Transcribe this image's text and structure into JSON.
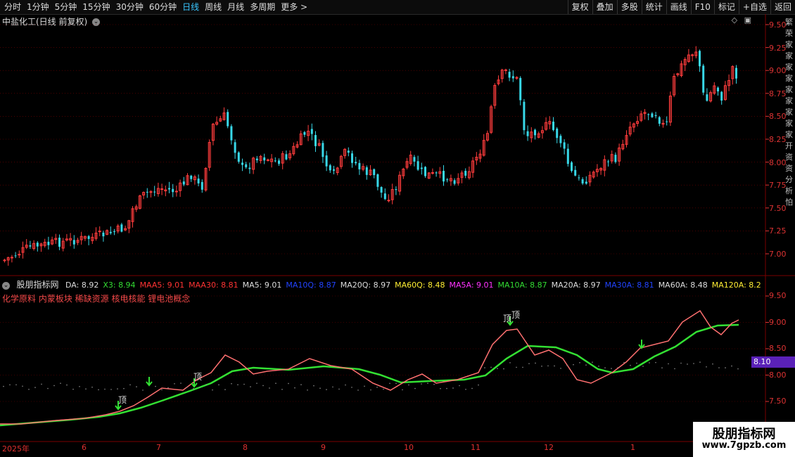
{
  "toolbar": {
    "periods": [
      "分时",
      "1分钟",
      "5分钟",
      "15分钟",
      "30分钟",
      "60分钟",
      "日线",
      "周线",
      "月线",
      "多周期",
      "更多 >"
    ],
    "active_period": "日线",
    "actions": [
      "复权",
      "叠加",
      "多股",
      "统计",
      "画线",
      "F10",
      "标记",
      "+自选",
      "返回"
    ]
  },
  "main_chart": {
    "title": "中盐化工(日线 前复权)",
    "price_ticks": [
      "9.50",
      "9.25",
      "9.00",
      "8.75",
      "8.50",
      "8.25",
      "8.00",
      "7.75",
      "7.50",
      "7.25",
      "7.00"
    ],
    "side_text": "繁荣家家家家家家家家家开资资分析怕"
  },
  "indicator": {
    "name": "股朋指标网",
    "values": [
      {
        "label": "DA: 8.92",
        "color": "#dddddd"
      },
      {
        "label": "X3: 8.94",
        "color": "#33dd33"
      },
      {
        "label": "MAA5: 9.01",
        "color": "#ff3333"
      },
      {
        "label": "MAA30: 8.81",
        "color": "#ff3333"
      },
      {
        "label": "MA5: 9.01",
        "color": "#dddddd"
      },
      {
        "label": "MA10Q: 8.87",
        "color": "#2244ff"
      },
      {
        "label": "MA20Q: 8.97",
        "color": "#dddddd"
      },
      {
        "label": "MA60Q: 8.48",
        "color": "#ffee33"
      },
      {
        "label": "MA5A: 9.01",
        "color": "#ff33ff"
      },
      {
        "label": "MA10A: 8.87",
        "color": "#33dd33"
      },
      {
        "label": "MA20A: 8.97",
        "color": "#dddddd"
      },
      {
        "label": "MA30A: 8.81",
        "color": "#2244ff"
      },
      {
        "label": "MA60A: 8.48",
        "color": "#dddddd"
      },
      {
        "label": "MA120A: 8.2",
        "color": "#ffee33"
      }
    ],
    "concepts": "化学原料 内蒙板块 稀缺资源 核电核能 锂电池概念",
    "price_ticks": [
      "9.50",
      "9.00",
      "8.50",
      "8.00",
      "7.50"
    ],
    "highlight_price": "8.10",
    "top_label": "顶"
  },
  "dates": [
    "2025年",
    "6",
    "7",
    "8",
    "9",
    "10",
    "11",
    "12",
    "1"
  ],
  "watermark": {
    "title": "股朋指标网",
    "url": "www.7gpzb.com"
  },
  "colors": {
    "up": "#ff3c3c",
    "down": "#38d8e8",
    "ma_fast": "#ff7070",
    "ma_slow": "#33e033",
    "grid": "#7a0000"
  }
}
